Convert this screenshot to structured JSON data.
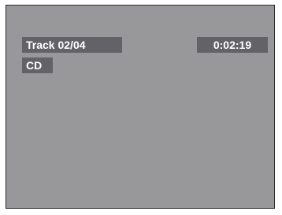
{
  "osd": {
    "track_label": "Track 02/04",
    "elapsed_time": "0:02:19",
    "disc_type": "CD"
  },
  "colors": {
    "screen_background": "#98989b",
    "osd_box_background": "#636367",
    "osd_text": "#ffffff"
  }
}
